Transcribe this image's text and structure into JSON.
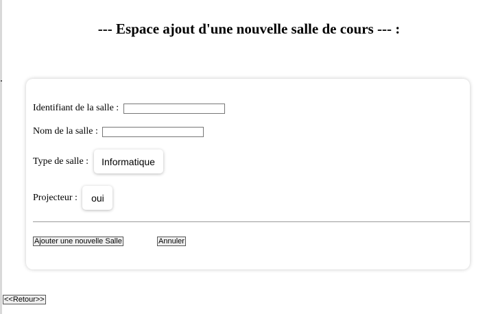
{
  "page": {
    "title": "--- Espace ajout d'une nouvelle salle de cours --- :"
  },
  "form": {
    "id_label": "Identifiant de la salle : ",
    "id_value": "",
    "name_label": "Nom de la salle : ",
    "name_value": "",
    "type_label": "Type de salle : ",
    "type_value": "Informatique",
    "projector_label": "Projecteur : ",
    "projector_value": "oui",
    "submit_label": "Ajouter une nouvelle Salle",
    "cancel_label": "Annuler"
  },
  "footer": {
    "back_label": "<<Retour>>"
  }
}
